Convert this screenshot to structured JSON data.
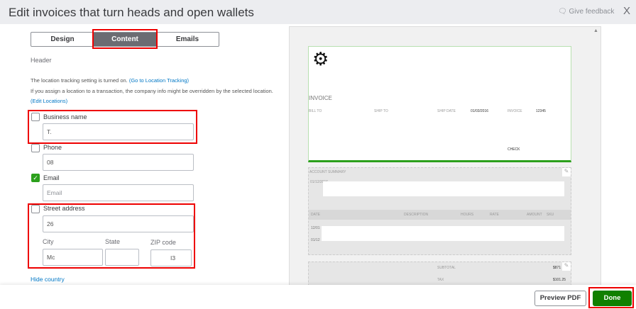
{
  "header": {
    "title": "Edit invoices that turn heads and open wallets",
    "feedback": "Give feedback",
    "close": "X"
  },
  "tabs": [
    {
      "label": "Design"
    },
    {
      "label": "Content",
      "active": true
    },
    {
      "label": "Emails"
    }
  ],
  "section": "Header",
  "info": {
    "line1": "The location tracking setting is turned on.",
    "link1": "(Go to Location Tracking)",
    "line2": "If you assign a location to a transaction, the company info might be overridden by the selected location.",
    "link2": "(Edit Locations)"
  },
  "fields": {
    "business_name": {
      "label": "Business name",
      "checked": false,
      "value": "T."
    },
    "phone": {
      "label": "Phone",
      "checked": false,
      "value": "08"
    },
    "email": {
      "label": "Email",
      "checked": true,
      "placeholder": "Email"
    },
    "street": {
      "label": "Street address",
      "checked": false,
      "value": "26"
    },
    "city": {
      "label": "City",
      "value": "Mc"
    },
    "state": {
      "label": "State",
      "value": ""
    },
    "zip": {
      "label": "ZIP code",
      "value": "I3"
    }
  },
  "hide_country": "Hide country",
  "preview": {
    "invoice_title": "INVOICE",
    "bill_to": "BILL TO",
    "ship_to": "SHIP TO",
    "ship_date_label": "SHIP DATE",
    "ship_date": "01/03/2016",
    "invoice_label": "INVOICE",
    "invoice_no": "12345",
    "check": "CHECK",
    "account_summary": "ACCOUNT SUMMARY",
    "date_row": "01/12/2016",
    "cols": [
      "DATE",
      "DESCRIPTION",
      "HOURS",
      "RATE",
      "AMOUNT",
      "SKU"
    ],
    "row1": "12/01",
    "row2": "01/12",
    "subtotal_label": "SUBTOTAL",
    "subtotal": "$871",
    "tax_label": "TAX",
    "tax": "$101.25"
  },
  "footer": {
    "preview_pdf": "Preview PDF",
    "done": "Done"
  },
  "colors": {
    "accent": "#2ca01c",
    "highlight": "#e00000"
  }
}
